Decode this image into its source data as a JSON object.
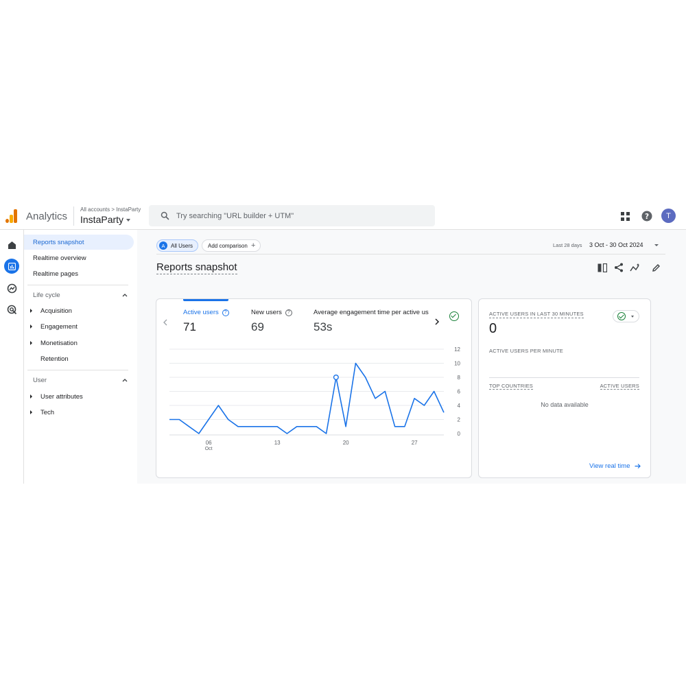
{
  "header": {
    "app_name": "Analytics",
    "breadcrumb": "All accounts > InstaParty",
    "property": "InstaParty",
    "search_placeholder": "Try searching \"URL builder + UTM\"",
    "avatar_initial": "T"
  },
  "sidebar": {
    "top_items": [
      {
        "label": "Reports snapshot",
        "active": true
      },
      {
        "label": "Realtime overview"
      },
      {
        "label": "Realtime pages"
      }
    ],
    "sections": [
      {
        "title": "Life cycle",
        "items": [
          {
            "label": "Acquisition",
            "expandable": true
          },
          {
            "label": "Engagement",
            "expandable": true
          },
          {
            "label": "Monetisation",
            "expandable": true
          },
          {
            "label": "Retention",
            "expandable": false
          }
        ]
      },
      {
        "title": "User",
        "items": [
          {
            "label": "User attributes",
            "expandable": true
          },
          {
            "label": "Tech",
            "expandable": true
          }
        ]
      }
    ]
  },
  "toolbar": {
    "segment_badge": "A",
    "segment_label": "All Users",
    "add_comparison": "Add comparison",
    "date_prefix": "Last 28 days",
    "date_range": "3 Oct - 30 Oct 2024"
  },
  "page": {
    "title": "Reports snapshot"
  },
  "metrics": [
    {
      "label": "Active users",
      "value": "71",
      "active": true
    },
    {
      "label": "New users",
      "value": "69"
    },
    {
      "label": "Average engagement time per active us",
      "value": "53s"
    }
  ],
  "chart_data": {
    "type": "line",
    "series": [
      {
        "values": [
          2,
          2,
          1,
          0,
          2,
          4,
          2,
          1,
          1,
          1,
          1,
          1,
          0,
          1,
          1,
          1,
          0,
          8,
          1,
          10,
          8,
          5,
          6,
          1,
          1,
          5,
          4,
          6,
          3
        ]
      }
    ],
    "x_start_day": 2,
    "x_ticks": [
      {
        "day": 6,
        "label": "06",
        "sub": "Oct"
      },
      {
        "day": 13,
        "label": "13"
      },
      {
        "day": 20,
        "label": "20"
      },
      {
        "day": 27,
        "label": "27"
      }
    ],
    "ylim": [
      0,
      12
    ],
    "y_ticks": [
      0,
      2,
      4,
      6,
      8,
      10,
      12
    ],
    "highlight_index": 17,
    "color": "#1a73e8"
  },
  "realtime": {
    "heading": "ACTIVE USERS IN LAST 30 MINUTES",
    "value": "0",
    "per_minute": "ACTIVE USERS PER MINUTE",
    "col_countries": "TOP COUNTRIES",
    "col_users": "ACTIVE USERS",
    "no_data": "No data available",
    "link": "View real time"
  }
}
